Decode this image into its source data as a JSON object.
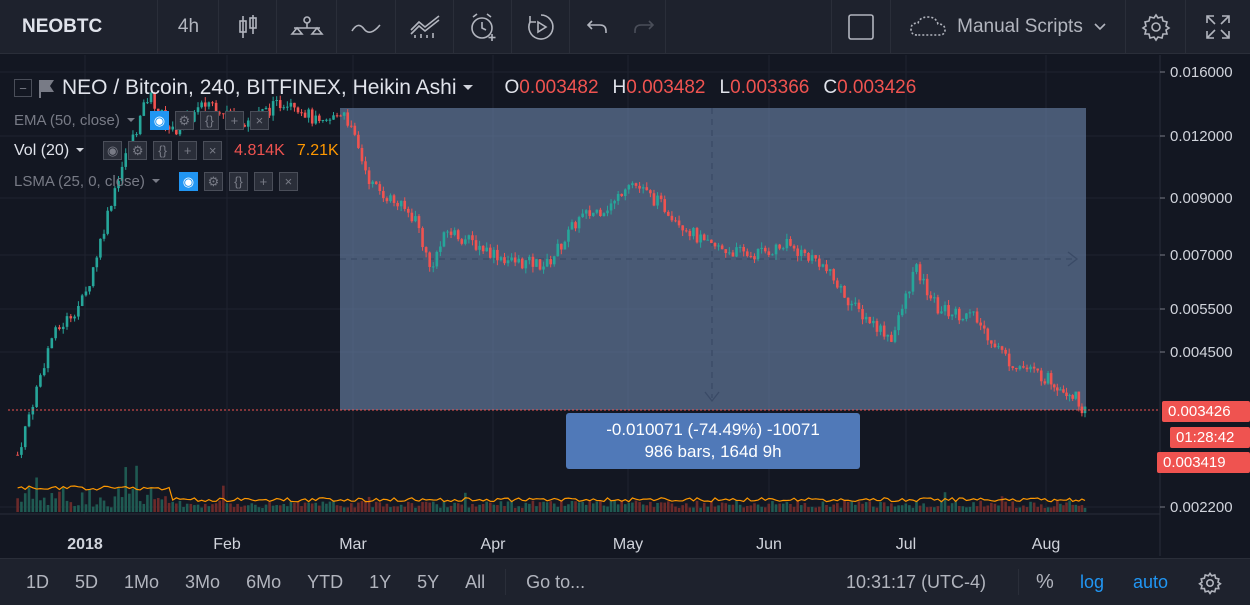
{
  "toolbar": {
    "symbol": "NEOBTC",
    "interval": "4h",
    "scripts_label": "Manual Scripts"
  },
  "legend": {
    "title": "NEO / Bitcoin, 240, BITFINEX, Heikin Ashi",
    "o_label": "O",
    "o_value": "0.003482",
    "h_label": "H",
    "h_value": "0.003482",
    "l_label": "L",
    "l_value": "0.003366",
    "c_label": "C",
    "c_value": "0.003426",
    "ema": "EMA (50, close)",
    "vol": "Vol (20)",
    "vol_value_1": "4.814K",
    "vol_value_2": "7.21K",
    "lsma": "LSMA (25, 0, close)"
  },
  "measure": {
    "line1": "-0.010071 (-74.49%) -10071",
    "line2": "986 bars, 164d 9h"
  },
  "price_axis": {
    "ticks": [
      "0.016000",
      "0.012000",
      "0.009000",
      "0.007000",
      "0.005500",
      "0.004500",
      "0.002200"
    ],
    "last_price": "0.003426",
    "countdown": "01:28:42",
    "second_price": "0.003419"
  },
  "time_axis": {
    "ticks": [
      "2018",
      "Feb",
      "Mar",
      "Apr",
      "May",
      "Jun",
      "Jul",
      "Aug"
    ]
  },
  "bottom": {
    "ranges": [
      "1D",
      "5D",
      "1Mo",
      "3Mo",
      "6Mo",
      "YTD",
      "1Y",
      "5Y",
      "All"
    ],
    "goto": "Go to...",
    "time": "10:31:17 (UTC-4)",
    "percent": "%",
    "log": "log",
    "auto": "auto"
  },
  "colors": {
    "background": "#131722",
    "up": "#26a69a",
    "down": "#ef5350",
    "measure_box": "#5079b8",
    "accent": "#2196f3"
  },
  "chart_data": {
    "type": "candlestick",
    "symbol": "NEOBTC",
    "exchange": "BITFINEX",
    "timeframe": "240",
    "style": "Heikin Ashi",
    "y_scale": "log",
    "ylim": [
      0.0022,
      0.016
    ],
    "x_ticks": [
      "2018",
      "Feb",
      "Mar",
      "Apr",
      "May",
      "Jun",
      "Jul",
      "Aug"
    ],
    "y_ticks": [
      0.016,
      0.012,
      0.009,
      0.007,
      0.0055,
      0.0045,
      0.0022
    ],
    "approx_price_path": [
      {
        "t": "2017-12-18",
        "p": 0.0028
      },
      {
        "t": "2017-12-25",
        "p": 0.0048
      },
      {
        "t": "2018-01-01",
        "p": 0.0058
      },
      {
        "t": "2018-01-08",
        "p": 0.0098
      },
      {
        "t": "2018-01-15",
        "p": 0.0145
      },
      {
        "t": "2018-01-20",
        "p": 0.0122
      },
      {
        "t": "2018-01-28",
        "p": 0.014
      },
      {
        "t": "2018-02-05",
        "p": 0.0128
      },
      {
        "t": "2018-02-15",
        "p": 0.0142
      },
      {
        "t": "2018-02-22",
        "p": 0.0125
      },
      {
        "t": "2018-02-27",
        "p": 0.0135
      },
      {
        "t": "2018-03-05",
        "p": 0.0096
      },
      {
        "t": "2018-03-15",
        "p": 0.0082
      },
      {
        "t": "2018-03-18",
        "p": 0.0066
      },
      {
        "t": "2018-03-22",
        "p": 0.0078
      },
      {
        "t": "2018-04-05",
        "p": 0.0068
      },
      {
        "t": "2018-04-13",
        "p": 0.0067
      },
      {
        "t": "2018-04-20",
        "p": 0.0082
      },
      {
        "t": "2018-04-28",
        "p": 0.0088
      },
      {
        "t": "2018-05-01",
        "p": 0.0098
      },
      {
        "t": "2018-05-10",
        "p": 0.0085
      },
      {
        "t": "2018-05-18",
        "p": 0.0073
      },
      {
        "t": "2018-05-28",
        "p": 0.007
      },
      {
        "t": "2018-06-05",
        "p": 0.0073
      },
      {
        "t": "2018-06-12",
        "p": 0.0068
      },
      {
        "t": "2018-06-20",
        "p": 0.0055
      },
      {
        "t": "2018-06-28",
        "p": 0.0048
      },
      {
        "t": "2018-07-03",
        "p": 0.0066
      },
      {
        "t": "2018-07-08",
        "p": 0.0055
      },
      {
        "t": "2018-07-16",
        "p": 0.0053
      },
      {
        "t": "2018-07-24",
        "p": 0.0043
      },
      {
        "t": "2018-08-01",
        "p": 0.004
      },
      {
        "t": "2018-08-08",
        "p": 0.0037
      },
      {
        "t": "2018-08-11",
        "p": 0.003426
      }
    ],
    "measurement": {
      "price_change": -0.010071,
      "percent_change": -74.49,
      "ticks": -10071,
      "bars": 986,
      "duration": "164d 9h"
    },
    "volume": {
      "length": 20,
      "values_shown": [
        "4.814K",
        "7.21K"
      ]
    },
    "indicators": [
      "EMA (50, close)",
      "Vol (20)",
      "LSMA (25, 0, close)"
    ]
  }
}
